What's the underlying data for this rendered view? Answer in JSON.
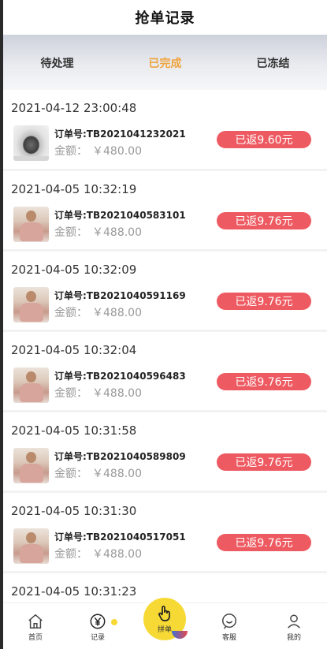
{
  "header": {
    "title": "抢单记录"
  },
  "tabs": [
    {
      "label": "待处理",
      "active": false
    },
    {
      "label": "已完成",
      "active": true
    },
    {
      "label": "已冻结",
      "active": false
    }
  ],
  "colors": {
    "accent": "#f0a43c",
    "rebate": "#ee5a61",
    "center": "#f7d935"
  },
  "amount_label": "金额：",
  "orders": [
    {
      "time": "2021-04-12 23:00:48",
      "order_no": "订单号:TB2021041232021",
      "amount": "￥480.00",
      "rebate": "已返9.60元",
      "thumb": "pan-image"
    },
    {
      "time": "2021-04-05 10:32:19",
      "order_no": "订单号:TB2021040583101",
      "amount": "￥488.00",
      "rebate": "已返9.76元",
      "thumb": "person-image"
    },
    {
      "time": "2021-04-05 10:32:09",
      "order_no": "订单号:TB2021040591169",
      "amount": "￥488.00",
      "rebate": "已返9.76元",
      "thumb": "person-image"
    },
    {
      "time": "2021-04-05 10:32:04",
      "order_no": "订单号:TB2021040596483",
      "amount": "￥488.00",
      "rebate": "已返9.76元",
      "thumb": "person-image"
    },
    {
      "time": "2021-04-05 10:31:58",
      "order_no": "订单号:TB2021040589809",
      "amount": "￥488.00",
      "rebate": "已返9.76元",
      "thumb": "person-image"
    },
    {
      "time": "2021-04-05 10:31:30",
      "order_no": "订单号:TB2021040517051",
      "amount": "￥488.00",
      "rebate": "已返9.76元",
      "thumb": "person-image"
    },
    {
      "time": "2021-04-05 10:31:23",
      "order_no": "",
      "amount": "",
      "rebate": "",
      "thumb": ""
    }
  ],
  "tabbar": {
    "home": "首页",
    "records": "记录",
    "grab": "拼单",
    "service": "客服",
    "mine": "我的"
  }
}
